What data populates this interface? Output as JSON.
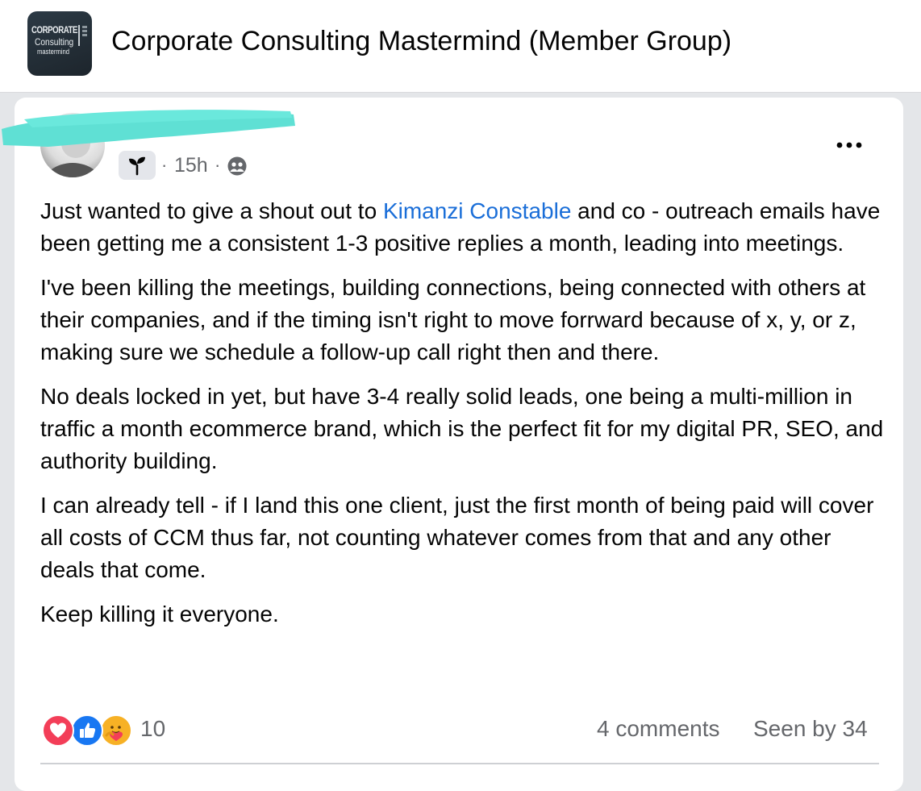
{
  "group": {
    "logo_line1": "CORPORATE",
    "logo_line2": "Consulting",
    "logo_line3": "mastermind",
    "title": "Corporate Consulting Mastermind (Member Group)"
  },
  "post": {
    "badge_icon": "sprout-icon",
    "time_sep_left": "·",
    "time": "15h",
    "time_sep_right": "·",
    "audience_icon": "members-icon",
    "more_icon": "more-options-icon",
    "paragraphs": [
      {
        "before": "Just wanted to give a shout out to ",
        "mention": "Kimanzi Constable",
        "after": " and co - outreach emails have been getting me a consistent 1-3 positive replies a month, leading into meetings."
      },
      {
        "text": "I've been killing the meetings, building connections, being connected with others at their companies, and if the timing isn't right to move forrward because of x, y, or z, making sure we schedule a follow-up call right then and there."
      },
      {
        "text": "No deals locked in yet, but have 3-4 really solid leads, one being a multi-million in traffic a month ecommerce brand, which is the perfect fit for my digital PR, SEO, and authority building."
      },
      {
        "text": "I can already tell - if I land this one client, just the first month of being paid will cover all costs of CCM thus far, not counting whatever comes from that and any other deals that come."
      },
      {
        "text": "Keep killing it everyone."
      }
    ],
    "reaction_icons": [
      "love-reaction-icon",
      "like-reaction-icon",
      "care-reaction-icon"
    ],
    "reaction_count": "10",
    "comments": "4 comments",
    "seen_by": "Seen by 34"
  },
  "colors": {
    "link": "#1a6ed8",
    "muted": "#65676b",
    "redaction": "#5fe0d4",
    "love": "#f33e58",
    "like": "#1877f2",
    "care": "#f7b125"
  }
}
